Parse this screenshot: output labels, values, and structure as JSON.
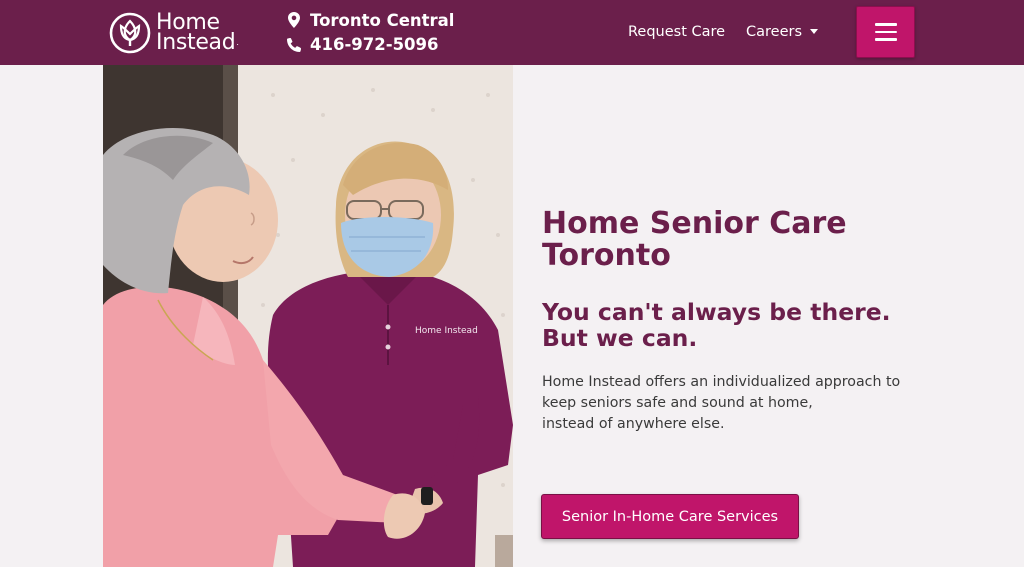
{
  "header": {
    "brand": {
      "line1": "Home",
      "line2": "Instead",
      "trademark": "."
    },
    "location": "Toronto Central",
    "phone": "416-972-5096",
    "nav": {
      "request_care": "Request Care",
      "careers": "Careers"
    },
    "menu_icon": "hamburger-icon",
    "colors": {
      "background": "#6b1f4b",
      "accent": "#c0156a"
    }
  },
  "photo": {
    "shirt_logo": "Home Instead"
  },
  "hero": {
    "title": "Home Senior Care Toronto",
    "subtitle": "You can't always be there. But we can.",
    "body_lines": [
      "Home Instead offers an individualized approach to",
      "keep seniors safe and sound at home,",
      "instead of anywhere else."
    ],
    "cta_label": "Senior In-Home Care Services",
    "colors": {
      "heading": "#6b1f4b",
      "body": "#3a3a3a",
      "button": "#c0156a"
    }
  }
}
